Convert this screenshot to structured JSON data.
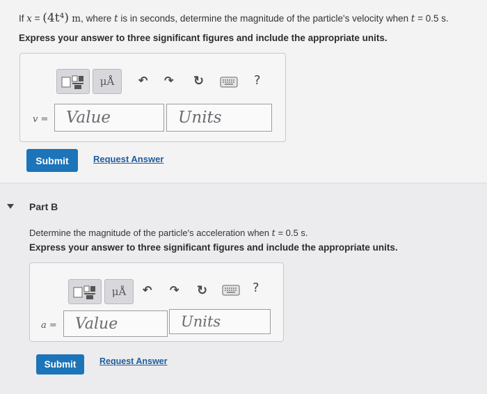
{
  "part_a": {
    "question_prefix": "If ",
    "question_x": "x",
    "question_eq": " = ",
    "question_expr": "(4t⁴)",
    "question_unit": " m",
    "question_mid": ", where ",
    "question_t": "t",
    "question_rest": " is in seconds, determine the magnitude of the particle's velocity when ",
    "question_t2": "t",
    "question_end": " = 0.5 s.",
    "instruction": "Express your answer to three significant figures and include the appropriate units.",
    "toolbar": {
      "units_symbol": "μÅ",
      "help": "?"
    },
    "variable_label": "v =",
    "value_placeholder": "Value",
    "units_placeholder": "Units",
    "submit_label": "Submit",
    "request_label": "Request Answer"
  },
  "part_b": {
    "title": "Part B",
    "question_main": "Determine the magnitude of the particle's acceleration when ",
    "question_t": "t",
    "question_end": " = 0.5 s.",
    "instruction": "Express your answer to three significant figures and include the appropriate units.",
    "toolbar": {
      "units_symbol": "μÅ",
      "help": "?"
    },
    "variable_label": "a =",
    "value_placeholder": "Value",
    "units_placeholder": "Units",
    "submit_label": "Submit",
    "request_label": "Request Answer"
  },
  "colors": {
    "accent": "#1d74b8",
    "link": "#1f5c9c",
    "background": "#f1f1f3"
  },
  "icons": [
    "templates-icon",
    "units-icon",
    "undo-icon",
    "redo-icon",
    "reset-icon",
    "keyboard-icon",
    "help-icon",
    "collapse-caret-icon"
  ]
}
